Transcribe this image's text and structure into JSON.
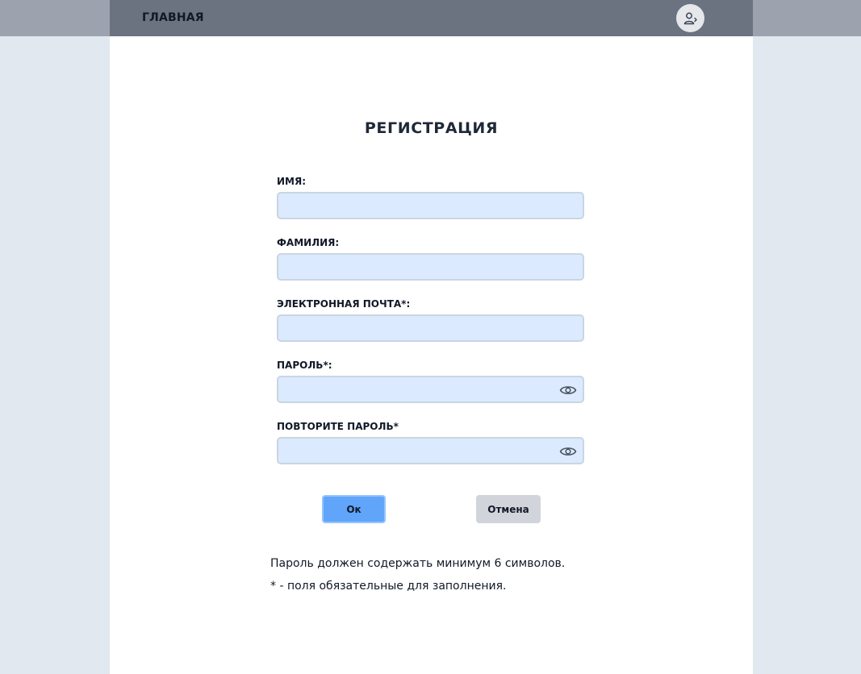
{
  "header": {
    "home_label": "ГЛАВНАЯ",
    "user_icon": "user-login-icon"
  },
  "form": {
    "title": "РЕГИСТРАЦИЯ",
    "fields": [
      {
        "label": "ИМЯ:",
        "value": "",
        "type": "text"
      },
      {
        "label": "ФАМИЛИЯ:",
        "value": "",
        "type": "text"
      },
      {
        "label": "ЭЛЕКТРОННАЯ ПОЧТА*:",
        "value": "",
        "type": "email"
      },
      {
        "label": "ПАРОЛЬ*:",
        "value": "",
        "type": "password",
        "icon": "eye-icon"
      },
      {
        "label": "ПОВТОРИТЕ ПАРОЛЬ*",
        "value": "",
        "type": "password",
        "icon": "eye-icon"
      }
    ],
    "ok_label": "Ок",
    "cancel_label": "Отмена"
  },
  "notes": {
    "password_rule": "Пароль должен содержать минимум 6 символов.",
    "required_hint": "* - поля обязательные для заполнения."
  },
  "colors": {
    "page_bg": "#e2e8f0",
    "navbar": "#6b7280",
    "input_bg": "#dbeafe",
    "ok_button": "#60a5fa",
    "cancel_button": "#d1d5db"
  }
}
